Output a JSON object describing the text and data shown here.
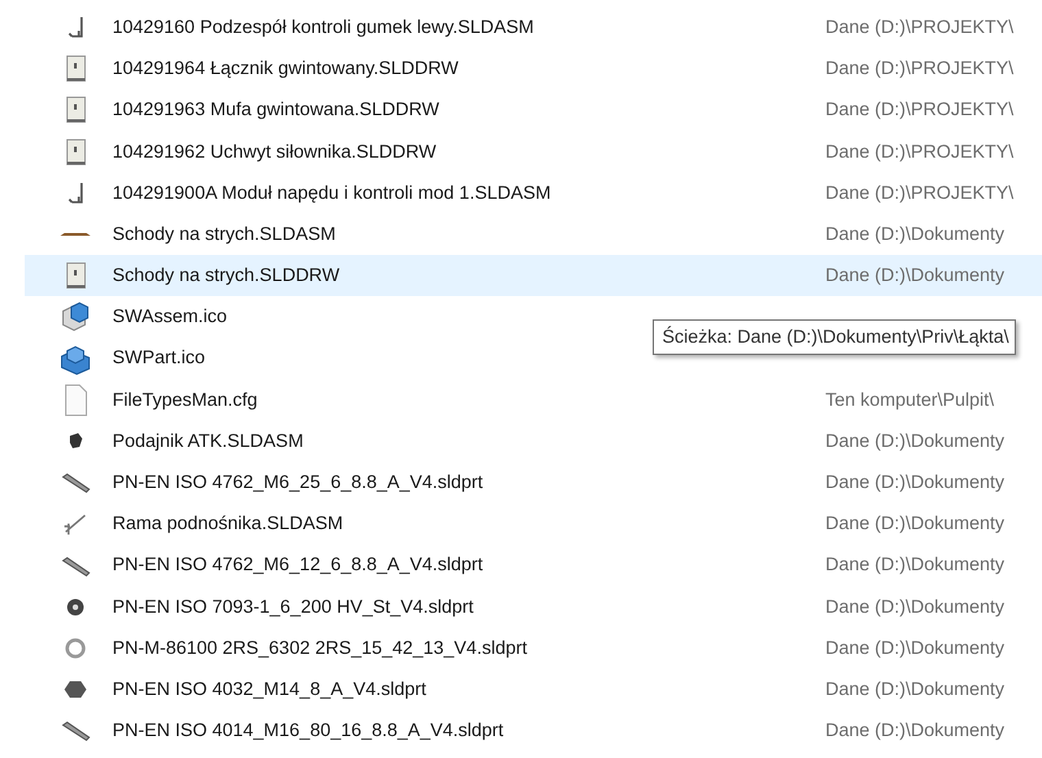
{
  "files": [
    {
      "name": "10429160 Podzespół kontroli gumek lewy.SLDASM",
      "location": "Dane (D:)\\PROJEKTY\\",
      "kind": "assembly",
      "selected": false
    },
    {
      "name": "104291964 Łącznik gwintowany.SLDDRW",
      "location": "Dane (D:)\\PROJEKTY\\",
      "kind": "drawing",
      "selected": false
    },
    {
      "name": "104291963 Mufa gwintowana.SLDDRW",
      "location": "Dane (D:)\\PROJEKTY\\",
      "kind": "drawing",
      "selected": false
    },
    {
      "name": "104291962 Uchwyt siłownika.SLDDRW",
      "location": "Dane (D:)\\PROJEKTY\\",
      "kind": "drawing",
      "selected": false
    },
    {
      "name": "104291900A Moduł napędu i kontroli mod 1.SLDASM",
      "location": "Dane (D:)\\PROJEKTY\\",
      "kind": "assembly",
      "selected": false
    },
    {
      "name": "Schody na strych.SLDASM",
      "location": "Dane (D:)\\Dokumenty",
      "kind": "beam",
      "selected": false
    },
    {
      "name": "Schody na strych.SLDDRW",
      "location": "Dane (D:)\\Dokumenty",
      "kind": "drawing",
      "selected": true
    },
    {
      "name": "SWAssem.ico",
      "kind": "assemblyicon",
      "selected": false
    },
    {
      "name": "SWPart.ico",
      "kind": "particon",
      "selected": false
    },
    {
      "name": "FileTypesMan.cfg",
      "location": "Ten komputer\\Pulpit\\",
      "kind": "blank",
      "selected": false
    },
    {
      "name": "Podajnik ATK.SLDASM",
      "location": "Dane (D:)\\Dokumenty",
      "kind": "blob",
      "selected": false
    },
    {
      "name": "PN-EN ISO 4762_M6_25_6_8.8_A_V4.sldprt",
      "location": "Dane (D:)\\Dokumenty",
      "kind": "bolt",
      "selected": false
    },
    {
      "name": "Rama podnośnika.SLDASM",
      "location": "Dane (D:)\\Dokumenty",
      "kind": "frame",
      "selected": false
    },
    {
      "name": "PN-EN ISO 4762_M6_12_6_8.8_A_V4.sldprt",
      "location": "Dane (D:)\\Dokumenty",
      "kind": "bolt",
      "selected": false
    },
    {
      "name": "PN-EN ISO 7093-1_6_200 HV_St_V4.sldprt",
      "location": "Dane (D:)\\Dokumenty",
      "kind": "washer",
      "selected": false
    },
    {
      "name": "PN-M-86100 2RS_6302 2RS_15_42_13_V4.sldprt",
      "location": "Dane (D:)\\Dokumenty",
      "kind": "bearing",
      "selected": false
    },
    {
      "name": "PN-EN ISO 4032_M14_8_A_V4.sldprt",
      "location": "Dane (D:)\\Dokumenty",
      "kind": "nut",
      "selected": false
    },
    {
      "name": "PN-EN ISO 4014_M16_80_16_8.8_A_V4.sldprt",
      "location": "Dane (D:)\\Dokumenty",
      "kind": "bolt",
      "selected": false
    }
  ],
  "tooltip": "Ścieżka: Dane (D:)\\Dokumenty\\Priv\\Łąkta\\"
}
